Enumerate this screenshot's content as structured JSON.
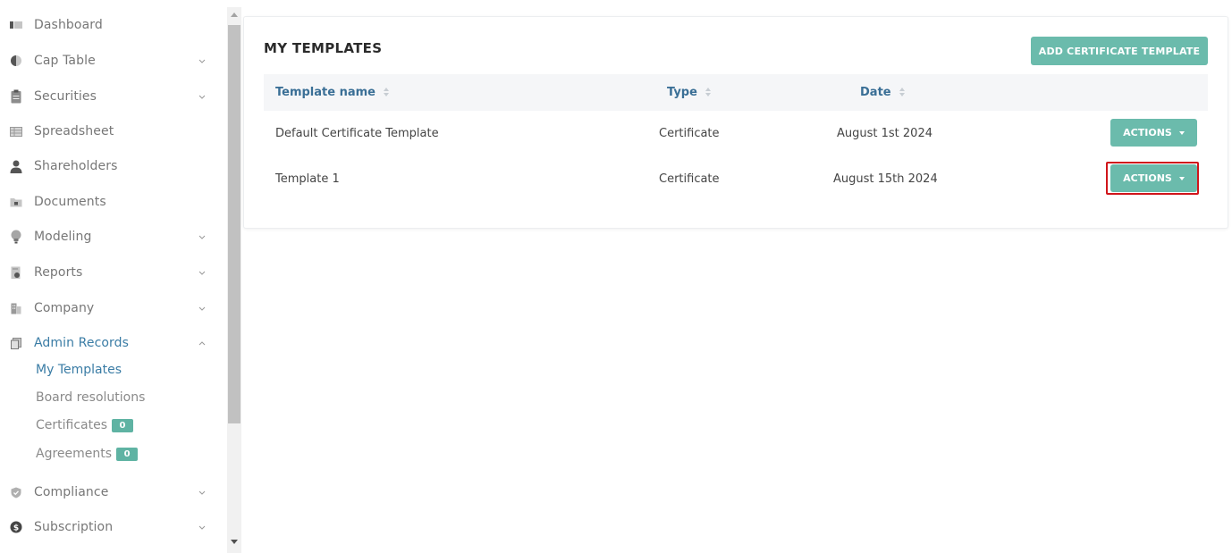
{
  "sidebar": {
    "items": [
      {
        "label": "Dashboard",
        "icon": "dashboard-icon"
      },
      {
        "label": "Cap Table",
        "icon": "pie-chart-icon"
      },
      {
        "label": "Securities",
        "icon": "clipboard-icon"
      },
      {
        "label": "Spreadsheet",
        "icon": "spreadsheet-icon"
      },
      {
        "label": "Shareholders",
        "icon": "user-icon"
      },
      {
        "label": "Documents",
        "icon": "folder-icon"
      },
      {
        "label": "Modeling",
        "icon": "lightbulb-icon"
      },
      {
        "label": "Reports",
        "icon": "report-icon"
      },
      {
        "label": "Company",
        "icon": "building-icon"
      },
      {
        "label": "Admin Records",
        "icon": "admin-records-icon"
      },
      {
        "label": "Compliance",
        "icon": "shield-check-icon"
      },
      {
        "label": "Subscription",
        "icon": "dollar-circle-icon"
      }
    ],
    "sub_items": [
      {
        "label": "My Templates"
      },
      {
        "label": "Board resolutions"
      },
      {
        "label": "Certificates",
        "badge": "0"
      },
      {
        "label": "Agreements",
        "badge": "0"
      }
    ]
  },
  "main": {
    "title": "MY TEMPLATES",
    "add_button": "ADD CERTIFICATE TEMPLATE",
    "columns": [
      "Template name",
      "Type",
      "Date"
    ],
    "rows": [
      {
        "name": "Default Certificate Template",
        "type": "Certificate",
        "date": "August 1st 2024",
        "action": "ACTIONS"
      },
      {
        "name": "Template 1",
        "type": "Certificate",
        "date": "August 15th 2024",
        "action": "ACTIONS"
      }
    ]
  },
  "colors": {
    "accent": "#6bbbac",
    "link": "#3a7ca5",
    "highlight": "#d0151b"
  }
}
